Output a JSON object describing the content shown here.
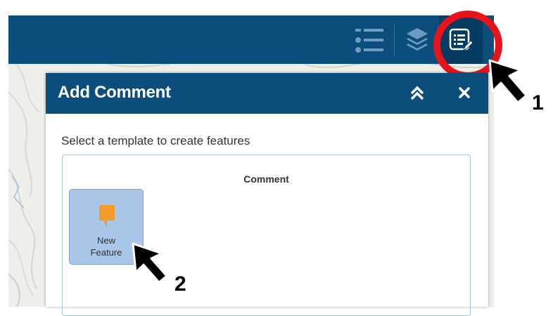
{
  "header": {
    "buttons": [
      {
        "name": "legend",
        "icon": "list-icon"
      },
      {
        "name": "layers",
        "icon": "layers-icon"
      },
      {
        "name": "edit",
        "icon": "edit-form-icon",
        "active": true
      }
    ]
  },
  "panel": {
    "title": "Add Comment",
    "collapse_icon": "double-chevron-up-icon",
    "close_icon": "close-icon",
    "instruction": "Select a template to create features",
    "template_group": "Comment",
    "template_item": {
      "label": "New\nFeature",
      "icon": "comment-marker-icon",
      "icon_color": "#f39c2a"
    }
  },
  "annotations": {
    "step1": "1",
    "step2": "2",
    "highlight_color": "#e8141b"
  },
  "colors": {
    "header": "#0b4e7b",
    "template_selected": "#a9c5e8"
  }
}
